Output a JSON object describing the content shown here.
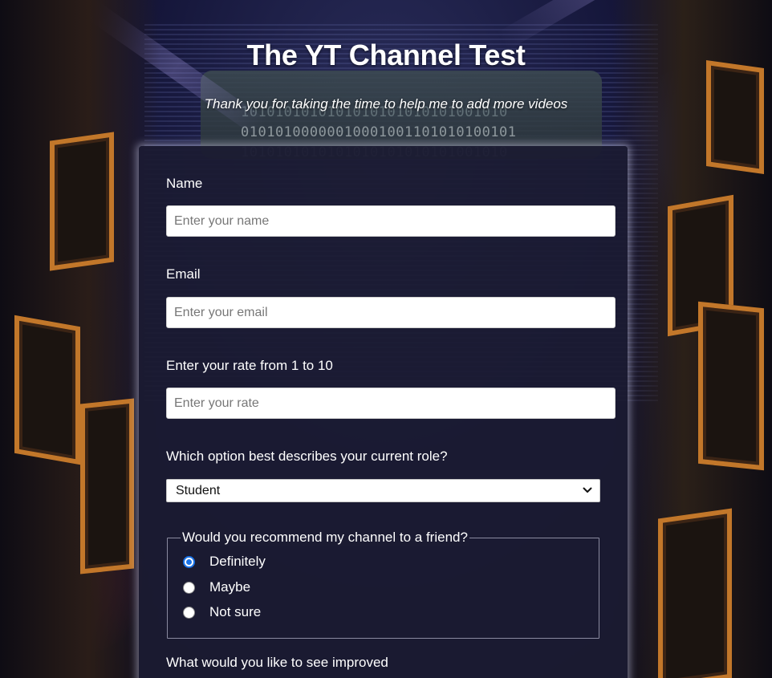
{
  "header": {
    "title": "The YT Channel Test",
    "subtitle": "Thank you for taking the time to help me to add more videos"
  },
  "background": {
    "binary_lines": [
      "1010101010101010101010101001010",
      "01010100000010001001101010100101",
      "1010101010101010101010101001010"
    ]
  },
  "form": {
    "name": {
      "label": "Name",
      "placeholder": "Enter your name",
      "value": ""
    },
    "email": {
      "label": "Email",
      "placeholder": "Enter your email",
      "value": ""
    },
    "rate": {
      "label": "Enter your rate from 1 to 10",
      "placeholder": "Enter your rate",
      "value": ""
    },
    "role": {
      "label": "Which option best describes your current role?",
      "selected": "Student",
      "icon": "chevron-down-icon"
    },
    "recommend": {
      "legend": "Would you recommend my channel to a friend?",
      "options": [
        {
          "label": "Definitely",
          "checked": true
        },
        {
          "label": "Maybe",
          "checked": false
        },
        {
          "label": "Not sure",
          "checked": false
        }
      ]
    },
    "improve": {
      "label": "What would you like to see improved"
    }
  },
  "colors": {
    "accent": "#1a73e8",
    "card_bg": "#1b1b32",
    "frame_orange": "#c2772a"
  }
}
